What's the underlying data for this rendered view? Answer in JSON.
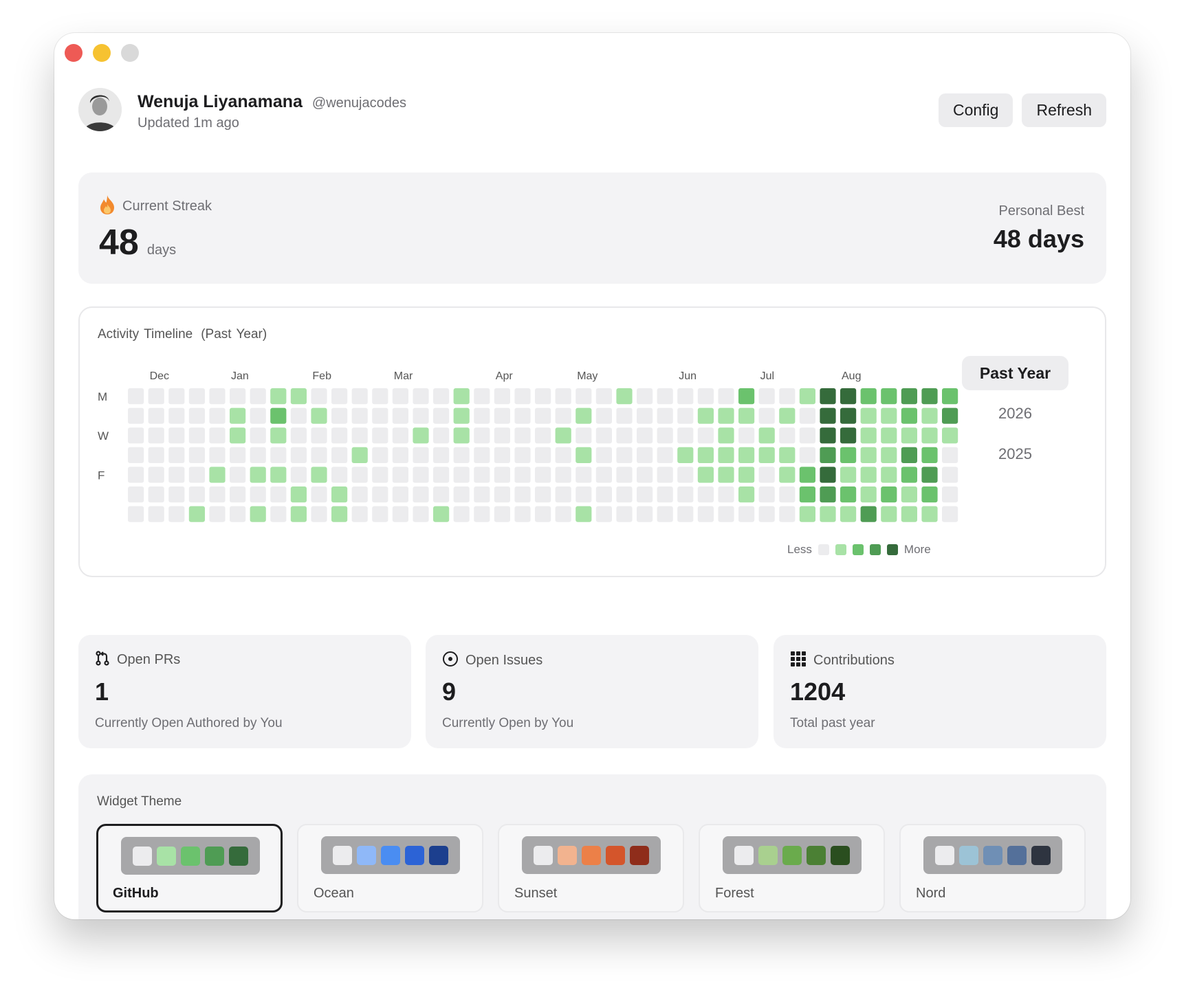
{
  "window": {
    "controls": [
      "close",
      "minimize",
      "zoom"
    ]
  },
  "user": {
    "name": "Wenuja Liyanamana",
    "handle": "@wenujacodes",
    "updated": "Updated 1m ago"
  },
  "header_buttons": {
    "config": "Config",
    "refresh": "Refresh"
  },
  "streak": {
    "label": "Current Streak",
    "icon": "flame-icon",
    "value": "48",
    "unit": "days",
    "best_label": "Personal Best",
    "best_value": "48 days"
  },
  "activity": {
    "title": "Activity Timeline",
    "subtitle": "(Past Year)",
    "months": [
      "Dec",
      "Jan",
      "Feb",
      "Mar",
      "Apr",
      "May",
      "Jun",
      "Jul",
      "Aug"
    ],
    "month_week_index": [
      1,
      5,
      9,
      13,
      18,
      22,
      27,
      31,
      35
    ],
    "day_labels": [
      "M",
      "",
      "W",
      "",
      "F",
      "",
      ""
    ],
    "legend_less": "Less",
    "legend_more": "More",
    "levels": [
      "#ececee",
      "#a8e2a6",
      "#6bc26d",
      "#4f9c54",
      "#356b3b"
    ],
    "years": [
      "Past Year",
      "2026",
      "2025"
    ],
    "selected_year": "Past Year",
    "weeks": [
      [
        0,
        0,
        0,
        0,
        0,
        0,
        0
      ],
      [
        0,
        0,
        0,
        0,
        0,
        0,
        0
      ],
      [
        0,
        0,
        0,
        0,
        0,
        0,
        0
      ],
      [
        0,
        0,
        0,
        0,
        0,
        0,
        1
      ],
      [
        0,
        0,
        0,
        0,
        1,
        0,
        0
      ],
      [
        0,
        1,
        1,
        0,
        0,
        0,
        0
      ],
      [
        0,
        0,
        0,
        0,
        1,
        0,
        1
      ],
      [
        1,
        2,
        1,
        0,
        1,
        0,
        0
      ],
      [
        1,
        0,
        0,
        0,
        0,
        1,
        1
      ],
      [
        0,
        1,
        0,
        0,
        1,
        0,
        0
      ],
      [
        0,
        0,
        0,
        0,
        0,
        1,
        1
      ],
      [
        0,
        0,
        0,
        1,
        0,
        0,
        0
      ],
      [
        0,
        0,
        0,
        0,
        0,
        0,
        0
      ],
      [
        0,
        0,
        0,
        0,
        0,
        0,
        0
      ],
      [
        0,
        0,
        1,
        0,
        0,
        0,
        0
      ],
      [
        0,
        0,
        0,
        0,
        0,
        0,
        1
      ],
      [
        1,
        1,
        1,
        0,
        0,
        0,
        0
      ],
      [
        0,
        0,
        0,
        0,
        0,
        0,
        0
      ],
      [
        0,
        0,
        0,
        0,
        0,
        0,
        0
      ],
      [
        0,
        0,
        0,
        0,
        0,
        0,
        0
      ],
      [
        0,
        0,
        0,
        0,
        0,
        0,
        0
      ],
      [
        0,
        0,
        1,
        0,
        0,
        0,
        0
      ],
      [
        0,
        1,
        0,
        1,
        0,
        0,
        1
      ],
      [
        0,
        0,
        0,
        0,
        0,
        0,
        0
      ],
      [
        1,
        0,
        0,
        0,
        0,
        0,
        0
      ],
      [
        0,
        0,
        0,
        0,
        0,
        0,
        0
      ],
      [
        0,
        0,
        0,
        0,
        0,
        0,
        0
      ],
      [
        0,
        0,
        0,
        1,
        0,
        0,
        0
      ],
      [
        0,
        1,
        0,
        1,
        1,
        0,
        0
      ],
      [
        0,
        1,
        1,
        1,
        1,
        0,
        0
      ],
      [
        2,
        1,
        0,
        1,
        1,
        1,
        0
      ],
      [
        0,
        0,
        1,
        1,
        0,
        0,
        0
      ],
      [
        0,
        1,
        0,
        1,
        1,
        0,
        0
      ],
      [
        1,
        0,
        0,
        0,
        2,
        2,
        1
      ],
      [
        4,
        4,
        4,
        3,
        4,
        3,
        1
      ],
      [
        4,
        4,
        4,
        2,
        1,
        2,
        1
      ],
      [
        2,
        1,
        1,
        1,
        1,
        1,
        3
      ],
      [
        2,
        1,
        1,
        1,
        1,
        2,
        1
      ],
      [
        3,
        2,
        1,
        3,
        2,
        1,
        1
      ],
      [
        3,
        1,
        1,
        2,
        3,
        2,
        1
      ],
      [
        2,
        3,
        1,
        0,
        0,
        0,
        0
      ]
    ]
  },
  "stats": [
    {
      "icon": "pull-request-icon",
      "label": "Open PRs",
      "value": "1",
      "sub": "Currently Open Authored by You"
    },
    {
      "icon": "issue-icon",
      "label": "Open Issues",
      "value": "9",
      "sub": "Currently Open by You"
    },
    {
      "icon": "grid-icon",
      "label": "Contributions",
      "value": "1204",
      "sub": "Total past year"
    }
  ],
  "themes": {
    "title": "Widget Theme",
    "selected": "GitHub",
    "items": [
      {
        "name": "GitHub",
        "colors": [
          "#ececee",
          "#a8e2a6",
          "#6bc26d",
          "#4f9c54",
          "#356b3b"
        ]
      },
      {
        "name": "Ocean",
        "colors": [
          "#ececee",
          "#8fb8f8",
          "#4a8df2",
          "#2c63d6",
          "#1c3f8e"
        ]
      },
      {
        "name": "Sunset",
        "colors": [
          "#ececee",
          "#f2b38f",
          "#ec8048",
          "#d4552b",
          "#8f2d1b"
        ]
      },
      {
        "name": "Forest",
        "colors": [
          "#ececee",
          "#a9d08f",
          "#6aab4c",
          "#4b8034",
          "#2a4e1f"
        ]
      },
      {
        "name": "Nord",
        "colors": [
          "#ececee",
          "#9cc3d6",
          "#6f8fb5",
          "#54709a",
          "#2e3440"
        ]
      }
    ]
  }
}
